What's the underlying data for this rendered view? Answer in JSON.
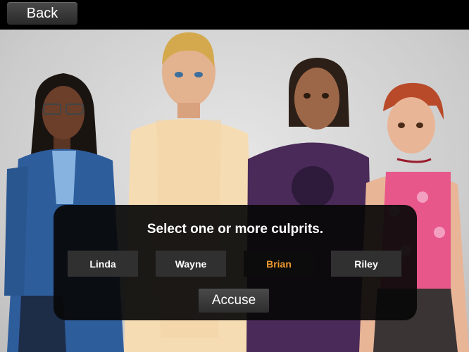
{
  "header": {
    "back_label": "Back"
  },
  "dialog": {
    "prompt": "Select one or more culprits.",
    "suspects": [
      {
        "name": "Linda",
        "selected": false
      },
      {
        "name": "Wayne",
        "selected": false
      },
      {
        "name": "Brian",
        "selected": true
      },
      {
        "name": "Riley",
        "selected": false
      }
    ],
    "accuse_label": "Accuse"
  },
  "colors": {
    "selected_text": "#f09a2e",
    "dialog_bg": "#080808",
    "button_bg": "#303030"
  }
}
